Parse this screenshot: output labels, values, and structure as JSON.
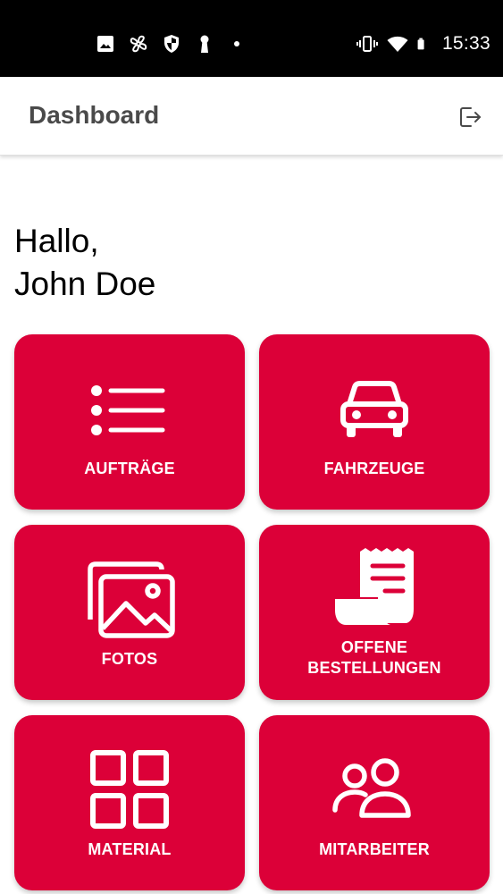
{
  "status_bar": {
    "left_icons": [
      "image-icon",
      "fan-icon",
      "shield-icon",
      "keyhole-icon",
      "dot-icon"
    ],
    "right_icons": [
      "vibrate-icon",
      "wifi-icon",
      "battery-icon"
    ],
    "time": "15:33"
  },
  "app_bar": {
    "title": "Dashboard",
    "logout_icon": "logout-icon"
  },
  "greeting": {
    "line1": "Hallo,",
    "line2": "John Doe"
  },
  "tiles": [
    {
      "label": "AUFTRÄGE",
      "icon": "list-icon"
    },
    {
      "label": "FAHRZEUGE",
      "icon": "car-icon"
    },
    {
      "label": "FOTOS",
      "icon": "photos-icon"
    },
    {
      "label_line1": "OFFENE",
      "label_line2": "BESTELLUNGEN",
      "icon": "receipt-icon"
    },
    {
      "label": "MATERIAL",
      "icon": "grid-icon"
    },
    {
      "label": "MITARBEITER",
      "icon": "people-icon"
    }
  ],
  "colors": {
    "tile_background": "#dc0038",
    "status_bar": "#000000",
    "title_text": "#4a4a4a"
  }
}
